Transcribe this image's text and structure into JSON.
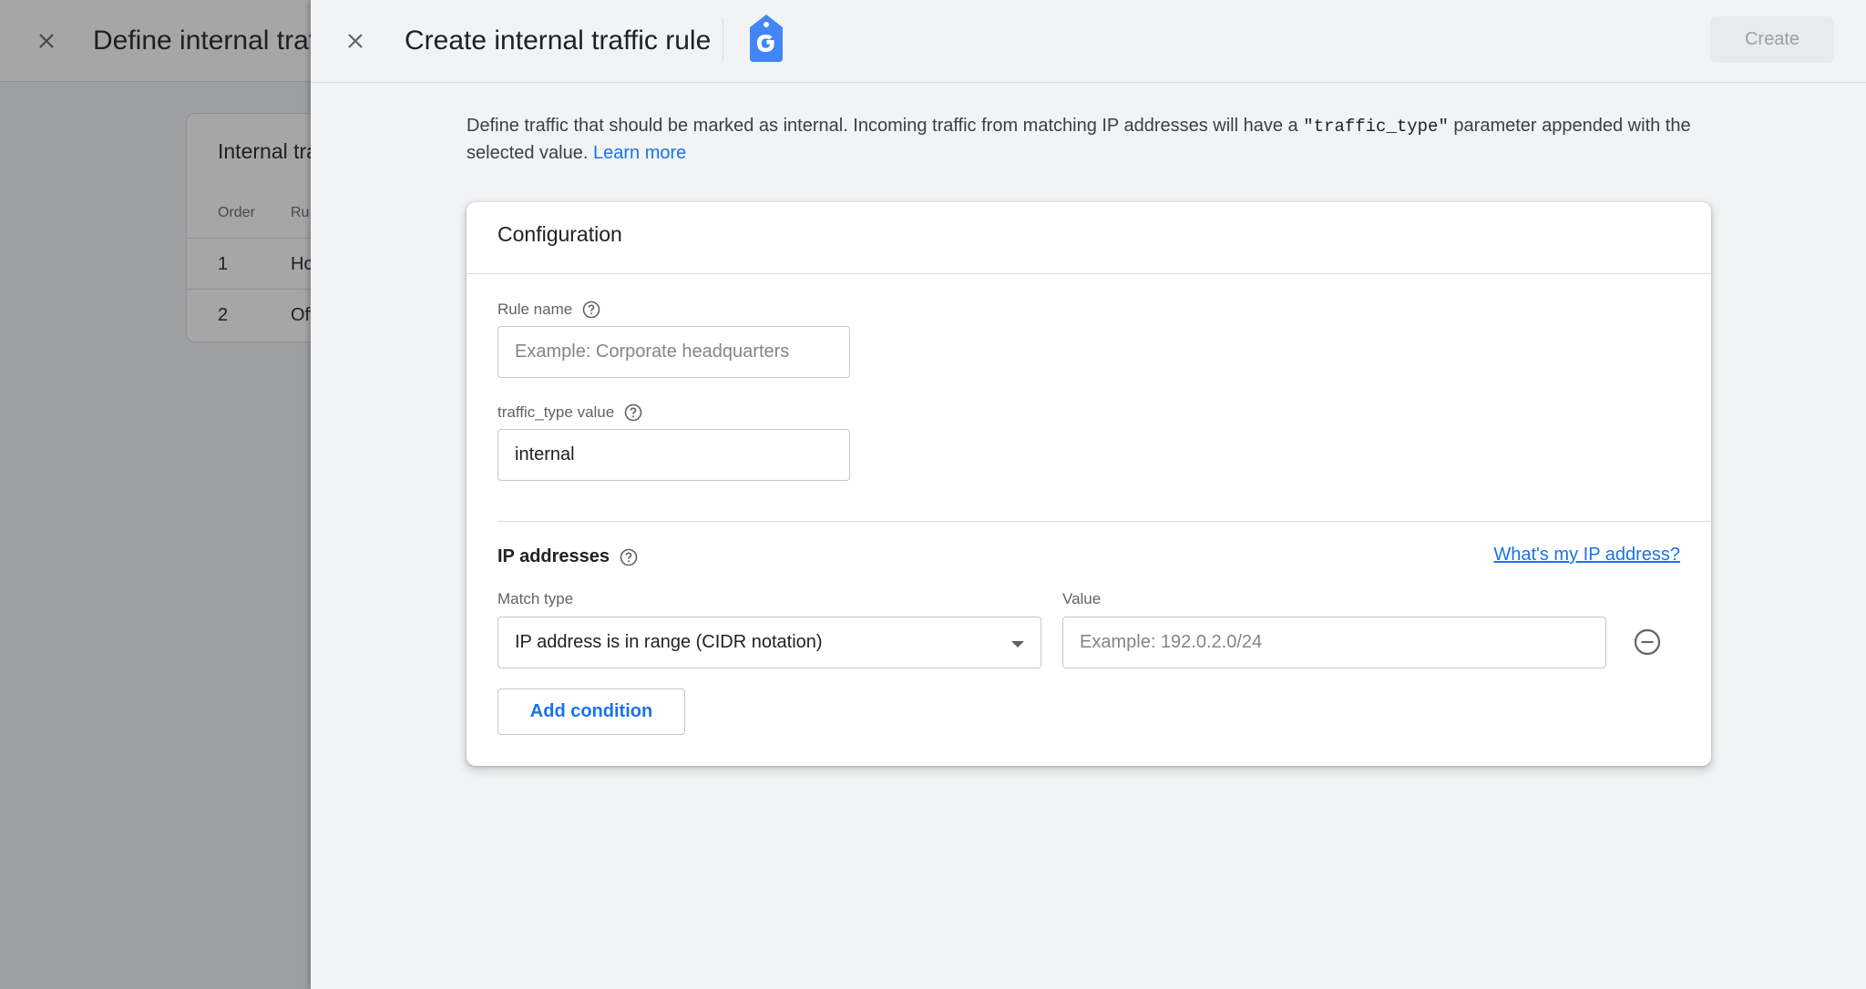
{
  "background": {
    "title": "Define internal traf",
    "card_title": "Internal tra",
    "columns": [
      "Order",
      "Ru"
    ],
    "rows": [
      {
        "order": "1",
        "rule": "Ho"
      },
      {
        "order": "2",
        "rule": "Off"
      }
    ]
  },
  "drawer": {
    "title": "Create internal traffic rule",
    "create_label": "Create",
    "logo_icon": "google-tag-icon",
    "intro": {
      "text_before": "Define traffic that should be marked as internal. Incoming traffic from matching IP addresses will have a ",
      "code": "\"traffic_type\"",
      "text_after": " parameter appended with the selected value. ",
      "link": "Learn more"
    },
    "config": {
      "title": "Configuration",
      "rule_name": {
        "label": "Rule name",
        "value": "",
        "placeholder": "Example: Corporate headquarters"
      },
      "traffic_type": {
        "label": "traffic_type value",
        "value": "internal",
        "placeholder": ""
      },
      "ip_section": {
        "title": "IP addresses",
        "whats_my_ip": "What's my IP address?",
        "match_type_label": "Match type",
        "match_type_value": "IP address is in range (CIDR notation)",
        "value_label": "Value",
        "value_placeholder": "Example: 192.0.2.0/24",
        "add_condition": "Add condition"
      }
    }
  },
  "colors": {
    "accent": "#1a73e8",
    "logo_blue": "#4285f4",
    "scrim": "#5f6368"
  }
}
